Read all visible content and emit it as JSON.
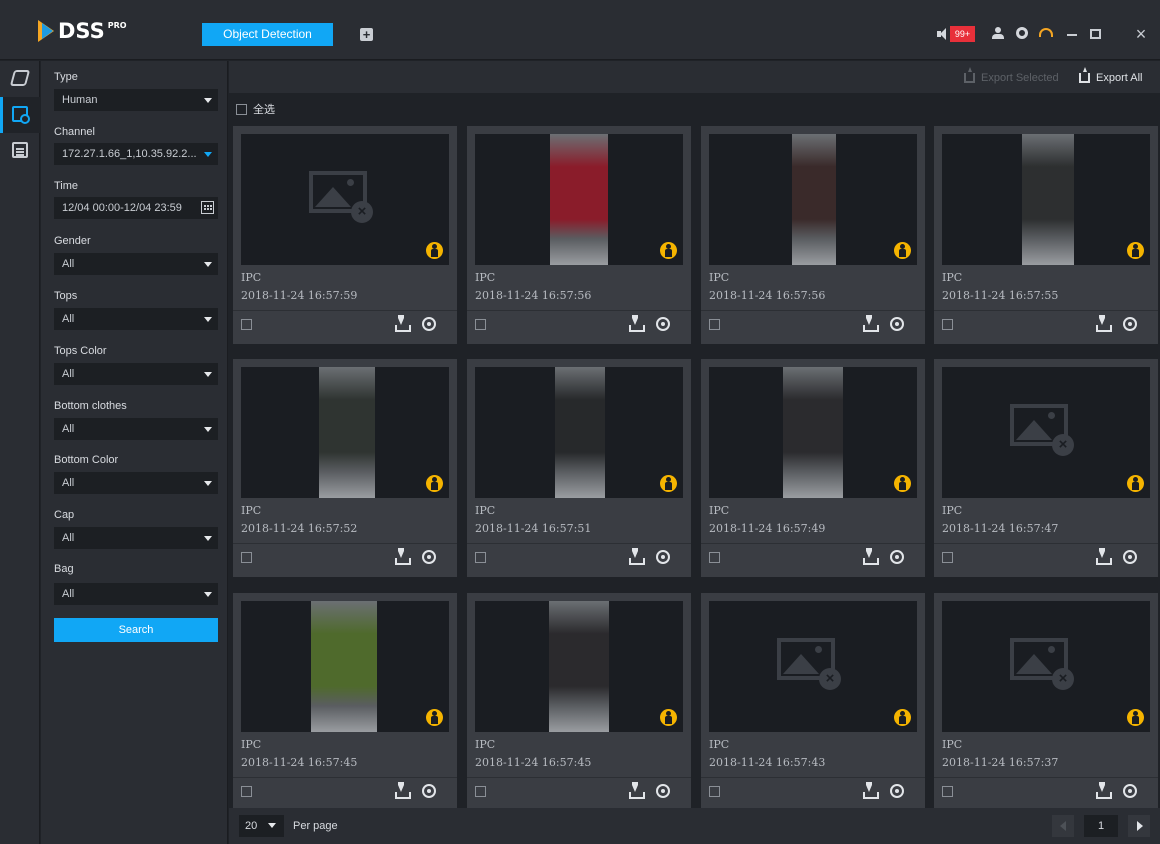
{
  "app": {
    "logo_text": "DSS",
    "logo_sup": "PRO"
  },
  "tabs": [
    {
      "label": "Object Detection"
    }
  ],
  "header": {
    "alarm_count": "99+"
  },
  "filters": {
    "type_label": "Type",
    "type_value": "Human",
    "channel_label": "Channel",
    "channel_value": "172.27.1.66_1,10.35.92.2...",
    "time_label": "Time",
    "time_value": "12/04 00:00-12/04 23:59",
    "gender_label": "Gender",
    "gender_value": "All",
    "tops_label": "Tops",
    "tops_value": "All",
    "tops_color_label": "Tops Color",
    "tops_color_value": "All",
    "bottom_label": "Bottom clothes",
    "bottom_value": "All",
    "bottom_color_label": "Bottom Color",
    "bottom_color_value": "All",
    "cap_label": "Cap",
    "cap_value": "All",
    "bag_label": "Bag",
    "bag_value": "All",
    "search_label": "Search"
  },
  "toolbar": {
    "export_selected": "Export Selected",
    "export_all": "Export All",
    "select_all": "全选"
  },
  "results": [
    {
      "source": "IPC",
      "time": "2018-11-24 16:57:59",
      "has_image": false
    },
    {
      "source": "IPC",
      "time": "2018-11-24 16:57:56",
      "has_image": true,
      "tone": "#8a1c2a"
    },
    {
      "source": "IPC",
      "time": "2018-11-24 16:57:56",
      "has_image": true,
      "tone": "#3a2a2a"
    },
    {
      "source": "IPC",
      "time": "2018-11-24 16:57:55",
      "has_image": true,
      "tone": "#2d2f30"
    },
    {
      "source": "IPC",
      "time": "2018-11-24 16:57:52",
      "has_image": true,
      "tone": "#2f3431"
    },
    {
      "source": "IPC",
      "time": "2018-11-24 16:57:51",
      "has_image": true,
      "tone": "#27292b"
    },
    {
      "source": "IPC",
      "time": "2018-11-24 16:57:49",
      "has_image": true,
      "tone": "#2b2b2e"
    },
    {
      "source": "IPC",
      "time": "2018-11-24 16:57:47",
      "has_image": false
    },
    {
      "source": "IPC",
      "time": "2018-11-24 16:57:45",
      "has_image": true,
      "tone": "#4f6a2c"
    },
    {
      "source": "IPC",
      "time": "2018-11-24 16:57:45",
      "has_image": true,
      "tone": "#2b2a2d"
    },
    {
      "source": "IPC",
      "time": "2018-11-24 16:57:43",
      "has_image": false
    },
    {
      "source": "IPC",
      "time": "2018-11-24 16:57:37",
      "has_image": false
    }
  ],
  "pagination": {
    "per_page_value": "20",
    "per_page_label": "Per page",
    "current_page": "1"
  },
  "colors": {
    "accent": "#11a7f5",
    "alarm": "#e8303a",
    "badge": "#f5b400"
  }
}
